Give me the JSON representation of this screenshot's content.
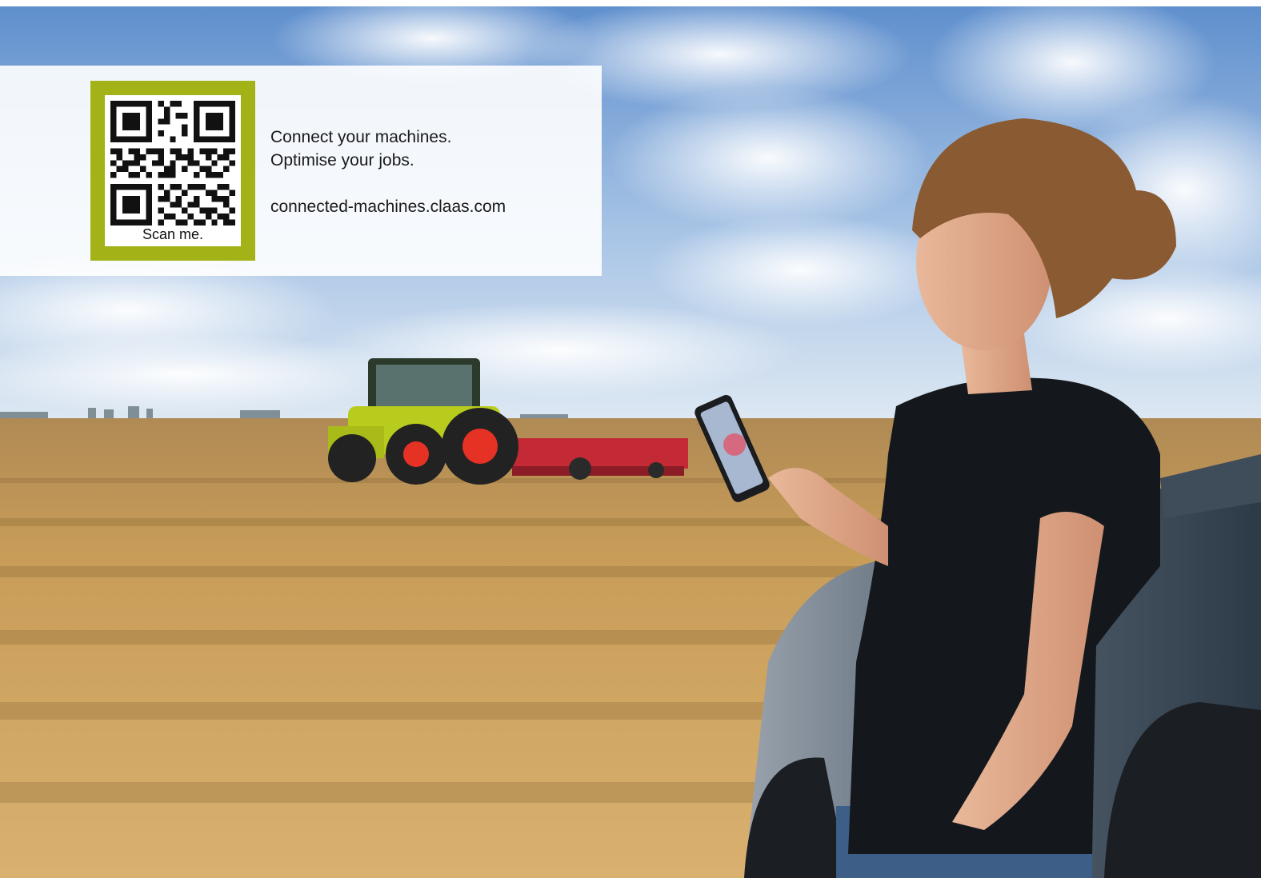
{
  "promo": {
    "headline_line1": "Connect your machines.",
    "headline_line2": "Optimise your jobs.",
    "url": "connected-machines.claas.com",
    "qr_caption": "Scan me."
  },
  "colors": {
    "accent_green": "#a3b216",
    "sky": "#7fa6d6",
    "field": "#c99a52",
    "tractor_body": "#b8cc1e",
    "wheel_rim": "#e53224"
  }
}
